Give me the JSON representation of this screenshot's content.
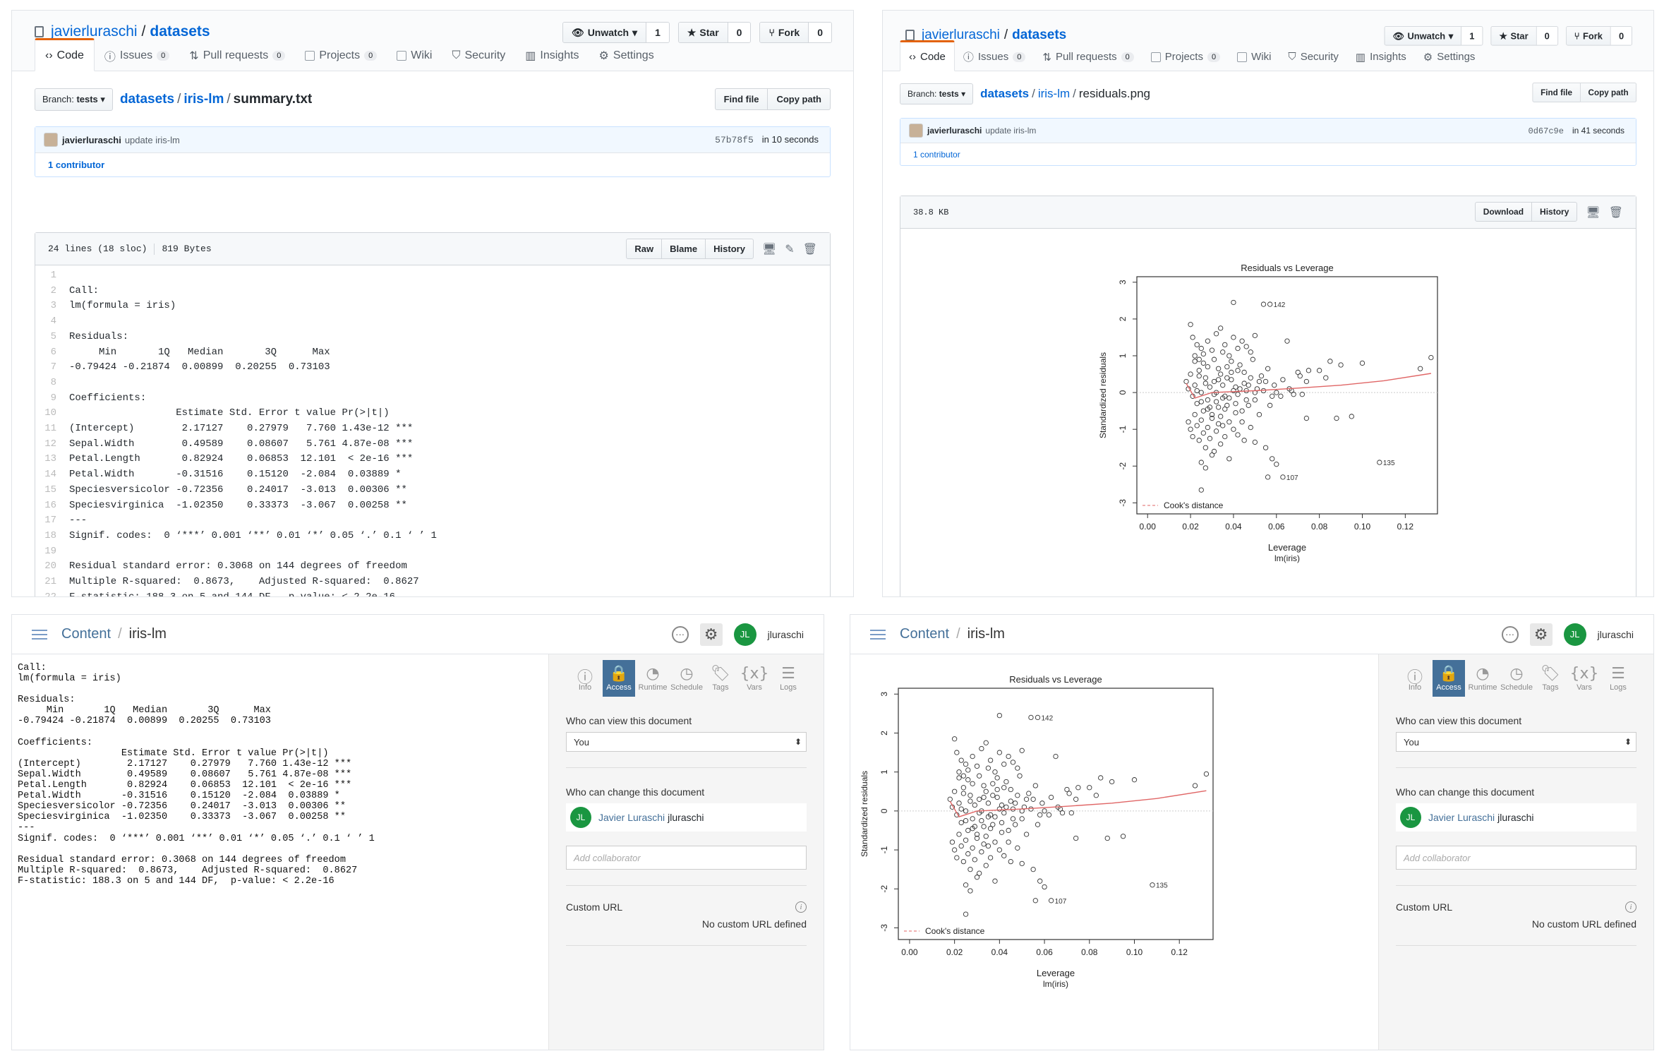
{
  "github": {
    "owner": "javierluraschi",
    "sep": "/",
    "repo": "datasets",
    "unwatch": "Unwatch",
    "unwatch_count": "1",
    "star": "Star",
    "star_count": "0",
    "fork": "Fork",
    "fork_count": "0",
    "tabs": [
      {
        "label": "Code"
      },
      {
        "label": "Issues",
        "count": "0"
      },
      {
        "label": "Pull requests",
        "count": "0"
      },
      {
        "label": "Projects",
        "count": "0"
      },
      {
        "label": "Wiki"
      },
      {
        "label": "Security"
      },
      {
        "label": "Insights"
      },
      {
        "label": "Settings"
      }
    ],
    "branch_prefix": "Branch:",
    "branch": "tests",
    "find_file": "Find file",
    "copy_path": "Copy path",
    "commit_user": "javierluraschi",
    "commit_msg": "update iris-lm",
    "contributors": "1 contributor",
    "raw": "Raw",
    "blame": "Blame",
    "history": "History",
    "download": "Download"
  },
  "left_file": {
    "dir1": "datasets",
    "dir2": "iris-lm",
    "file": "summary.txt",
    "sha": "57b78f5",
    "time": "in 10 seconds",
    "lines": "24 lines (18 sloc)",
    "size": "819 Bytes",
    "code": [
      "",
      "Call:",
      "lm(formula = iris)",
      "",
      "Residuals:",
      "     Min       1Q   Median       3Q      Max ",
      "-0.79424 -0.21874  0.00899  0.20255  0.73103 ",
      "",
      "Coefficients:",
      "                  Estimate Std. Error t value Pr(>|t|)    ",
      "(Intercept)        2.17127    0.27979   7.760 1.43e-12 ***",
      "Sepal.Width        0.49589    0.08607   5.761 4.87e-08 ***",
      "Petal.Length       0.82924    0.06853  12.101  < 2e-16 ***",
      "Petal.Width       -0.31516    0.15120  -2.084  0.03889 *  ",
      "Speciesversicolor -0.72356    0.24017  -3.013  0.00306 ** ",
      "Speciesvirginica  -1.02350    0.33373  -3.067  0.00258 ** ",
      "---",
      "Signif. codes:  0 ‘***’ 0.001 ‘**’ 0.01 ‘*’ 0.05 ‘.’ 0.1 ‘ ’ 1",
      "",
      "Residual standard error: 0.3068 on 144 degrees of freedom",
      "Multiple R-squared:  0.8673,\tAdjusted R-squared:  0.8627 ",
      "F-statistic: 188.3 on 5 and 144 DF,  p-value: < 2.2e-16",
      ""
    ]
  },
  "right_file": {
    "dir1": "datasets",
    "dir2": "iris-lm",
    "file": "residuals.png",
    "sha": "0d67c9e",
    "time": "in 41 seconds",
    "size": "38.8 KB"
  },
  "connect": {
    "content": "Content",
    "sep": "/",
    "name": "iris-lm",
    "user_initials": "JL",
    "user": "jluraschi",
    "sidebar_icons": [
      {
        "label": "Info",
        "icon": "info-icon"
      },
      {
        "label": "Access",
        "icon": "lock-icon"
      },
      {
        "label": "Runtime",
        "icon": "gauge-icon"
      },
      {
        "label": "Schedule",
        "icon": "clock-icon"
      },
      {
        "label": "Tags",
        "icon": "tag-icon"
      },
      {
        "label": "Vars",
        "icon": "vars-icon"
      },
      {
        "label": "Logs",
        "icon": "logs-icon"
      }
    ],
    "who_view_label": "Who can view this document",
    "who_view_value": "You",
    "who_change_label": "Who can change this document",
    "collab_name": "Javier Luraschi",
    "collab_user": "jluraschi",
    "add_collab_placeholder": "Add collaborator",
    "custom_url_label": "Custom URL",
    "custom_url_value": "No custom URL defined",
    "output": "Call:\nlm(formula = iris)\n\nResiduals:\n     Min       1Q   Median       3Q      Max \n-0.79424 -0.21874  0.00899  0.20255  0.73103 \n\nCoefficients:\n                  Estimate Std. Error t value Pr(>|t|)    \n(Intercept)        2.17127    0.27979   7.760 1.43e-12 ***\nSepal.Width        0.49589    0.08607   5.761 4.87e-08 ***\nPetal.Length       0.82924    0.06853  12.101  < 2e-16 ***\nPetal.Width       -0.31516    0.15120  -2.084  0.03889 *  \nSpeciesversicolor -0.72356    0.24017  -3.013  0.00306 ** \nSpeciesvirginica  -1.02350    0.33373  -3.067  0.00258 ** \n---\nSignif. codes:  0 ‘***’ 0.001 ‘**’ 0.01 ‘*’ 0.05 ‘.’ 0.1 ‘ ’ 1\n\nResidual standard error: 0.3068 on 144 degrees of freedom\nMultiple R-squared:  0.8673,\tAdjusted R-squared:  0.8627 \nF-statistic: 188.3 on 5 and 144 DF,  p-value: < 2.2e-16"
  },
  "chart_data": {
    "type": "scatter",
    "title": "Residuals vs Leverage",
    "xlabel": "Leverage",
    "xsublabel": "lm(iris)",
    "ylabel": "Standardized residuals",
    "xlim": [
      -0.005,
      0.135
    ],
    "ylim": [
      -3.3,
      3.15
    ],
    "xticks": [
      "0.00",
      "0.02",
      "0.04",
      "0.06",
      "0.08",
      "0.10",
      "0.12"
    ],
    "yticks": [
      "-3",
      "-2",
      "-1",
      "0",
      "1",
      "2",
      "3"
    ],
    "legend": "Cook's distance",
    "legend_position": "bottom-left",
    "labeled_points": [
      {
        "label": "142",
        "x": 0.057,
        "y": 2.4
      },
      {
        "label": "107",
        "x": 0.063,
        "y": -2.3
      },
      {
        "label": "135",
        "x": 0.108,
        "y": -1.9
      }
    ],
    "smooth": [
      [
        0.018,
        0.25
      ],
      [
        0.022,
        -0.15
      ],
      [
        0.03,
        0.0
      ],
      [
        0.05,
        0.05
      ],
      [
        0.07,
        0.12
      ],
      [
        0.09,
        0.2
      ],
      [
        0.11,
        0.32
      ],
      [
        0.132,
        0.52
      ]
    ],
    "points": [
      [
        0.02,
        1.85
      ],
      [
        0.021,
        1.5
      ],
      [
        0.023,
        1.3
      ],
      [
        0.025,
        1.2
      ],
      [
        0.022,
        1.0
      ],
      [
        0.024,
        0.9
      ],
      [
        0.026,
        0.8
      ],
      [
        0.028,
        1.4
      ],
      [
        0.03,
        1.15
      ],
      [
        0.032,
        1.6
      ],
      [
        0.034,
        1.75
      ],
      [
        0.036,
        1.3
      ],
      [
        0.038,
        1.0
      ],
      [
        0.04,
        1.5
      ],
      [
        0.042,
        1.2
      ],
      [
        0.044,
        1.4
      ],
      [
        0.046,
        1.25
      ],
      [
        0.048,
        1.1
      ],
      [
        0.05,
        1.55
      ],
      [
        0.04,
        2.45
      ],
      [
        0.054,
        2.4
      ],
      [
        0.065,
        1.4
      ],
      [
        0.07,
        0.55
      ],
      [
        0.075,
        0.6
      ],
      [
        0.085,
        0.85
      ],
      [
        0.09,
        0.75
      ],
      [
        0.1,
        0.8
      ],
      [
        0.127,
        0.65
      ],
      [
        0.132,
        0.95
      ],
      [
        0.018,
        0.3
      ],
      [
        0.019,
        0.1
      ],
      [
        0.02,
        0.5
      ],
      [
        0.021,
        -0.1
      ],
      [
        0.022,
        0.2
      ],
      [
        0.023,
        -0.3
      ],
      [
        0.024,
        0.6
      ],
      [
        0.025,
        0.0
      ],
      [
        0.026,
        -0.5
      ],
      [
        0.027,
        0.4
      ],
      [
        0.028,
        -0.2
      ],
      [
        0.029,
        0.15
      ],
      [
        0.03,
        -0.6
      ],
      [
        0.031,
        0.3
      ],
      [
        0.032,
        0.0
      ],
      [
        0.033,
        -0.4
      ],
      [
        0.034,
        0.5
      ],
      [
        0.035,
        0.2
      ],
      [
        0.036,
        -0.1
      ],
      [
        0.037,
        0.7
      ],
      [
        0.038,
        -0.8
      ],
      [
        0.039,
        0.35
      ],
      [
        0.04,
        0.05
      ],
      [
        0.041,
        -0.3
      ],
      [
        0.042,
        0.6
      ],
      [
        0.043,
        0.1
      ],
      [
        0.044,
        -0.5
      ],
      [
        0.045,
        0.25
      ],
      [
        0.046,
        -0.2
      ],
      [
        0.048,
        0.4
      ],
      [
        0.05,
        0.0
      ],
      [
        0.052,
        -0.6
      ],
      [
        0.055,
        0.3
      ],
      [
        0.058,
        -0.1
      ],
      [
        0.06,
        0.0
      ],
      [
        0.062,
        -0.1
      ],
      [
        0.066,
        0.1
      ],
      [
        0.068,
        -0.05
      ],
      [
        0.072,
        -0.05
      ],
      [
        0.074,
        0.3
      ],
      [
        0.08,
        0.6
      ],
      [
        0.083,
        0.4
      ],
      [
        0.074,
        -0.7
      ],
      [
        0.088,
        -0.7
      ],
      [
        0.095,
        -0.65
      ],
      [
        0.019,
        -0.8
      ],
      [
        0.02,
        -1.0
      ],
      [
        0.021,
        -1.2
      ],
      [
        0.022,
        -0.6
      ],
      [
        0.023,
        -0.9
      ],
      [
        0.024,
        -1.3
      ],
      [
        0.025,
        -0.75
      ],
      [
        0.026,
        -1.1
      ],
      [
        0.027,
        -1.5
      ],
      [
        0.028,
        -0.95
      ],
      [
        0.029,
        -1.25
      ],
      [
        0.03,
        -0.7
      ],
      [
        0.031,
        -1.6
      ],
      [
        0.032,
        -1.05
      ],
      [
        0.033,
        -0.85
      ],
      [
        0.034,
        -1.4
      ],
      [
        0.035,
        -0.9
      ],
      [
        0.036,
        -1.2
      ],
      [
        0.038,
        -1.8
      ],
      [
        0.04,
        -1.0
      ],
      [
        0.042,
        -1.15
      ],
      [
        0.045,
        -1.3
      ],
      [
        0.048,
        -0.95
      ],
      [
        0.05,
        -1.35
      ],
      [
        0.055,
        -1.5
      ],
      [
        0.058,
        -1.8
      ],
      [
        0.06,
        -1.95
      ],
      [
        0.056,
        -2.3
      ],
      [
        0.027,
        -2.05
      ],
      [
        0.025,
        -1.9
      ],
      [
        0.03,
        -1.7
      ],
      [
        0.022,
        0.85
      ],
      [
        0.024,
        0.45
      ],
      [
        0.026,
        1.05
      ],
      [
        0.028,
        0.7
      ],
      [
        0.031,
        0.9
      ],
      [
        0.033,
        0.65
      ],
      [
        0.035,
        1.1
      ],
      [
        0.037,
        0.4
      ],
      [
        0.039,
        0.85
      ],
      [
        0.041,
        0.15
      ],
      [
        0.043,
        0.75
      ],
      [
        0.045,
        0.55
      ],
      [
        0.047,
        0.2
      ],
      [
        0.049,
        0.9
      ],
      [
        0.051,
        0.1
      ],
      [
        0.053,
        0.45
      ],
      [
        0.056,
        0.65
      ],
      [
        0.059,
        0.2
      ],
      [
        0.063,
        0.35
      ],
      [
        0.067,
        0.05
      ],
      [
        0.071,
        0.45
      ],
      [
        0.025,
        -2.65
      ],
      [
        0.028,
        -0.45
      ],
      [
        0.032,
        -0.25
      ],
      [
        0.034,
        -0.65
      ],
      [
        0.036,
        -0.45
      ],
      [
        0.038,
        -0.15
      ],
      [
        0.041,
        -0.55
      ],
      [
        0.044,
        -0.8
      ],
      [
        0.047,
        -0.35
      ],
      [
        0.023,
        0.05
      ],
      [
        0.025,
        -0.25
      ],
      [
        0.027,
        0.25
      ],
      [
        0.029,
        -0.4
      ],
      [
        0.031,
        -0.05
      ],
      [
        0.033,
        0.35
      ],
      [
        0.035,
        -0.15
      ],
      [
        0.037,
        -0.35
      ],
      [
        0.039,
        0.55
      ],
      [
        0.042,
        -0.05
      ],
      [
        0.046,
        0.05
      ],
      [
        0.05,
        -0.2
      ],
      [
        0.052,
        0.3
      ],
      [
        0.054,
        0.05
      ],
      [
        0.057,
        -0.35
      ]
    ]
  }
}
